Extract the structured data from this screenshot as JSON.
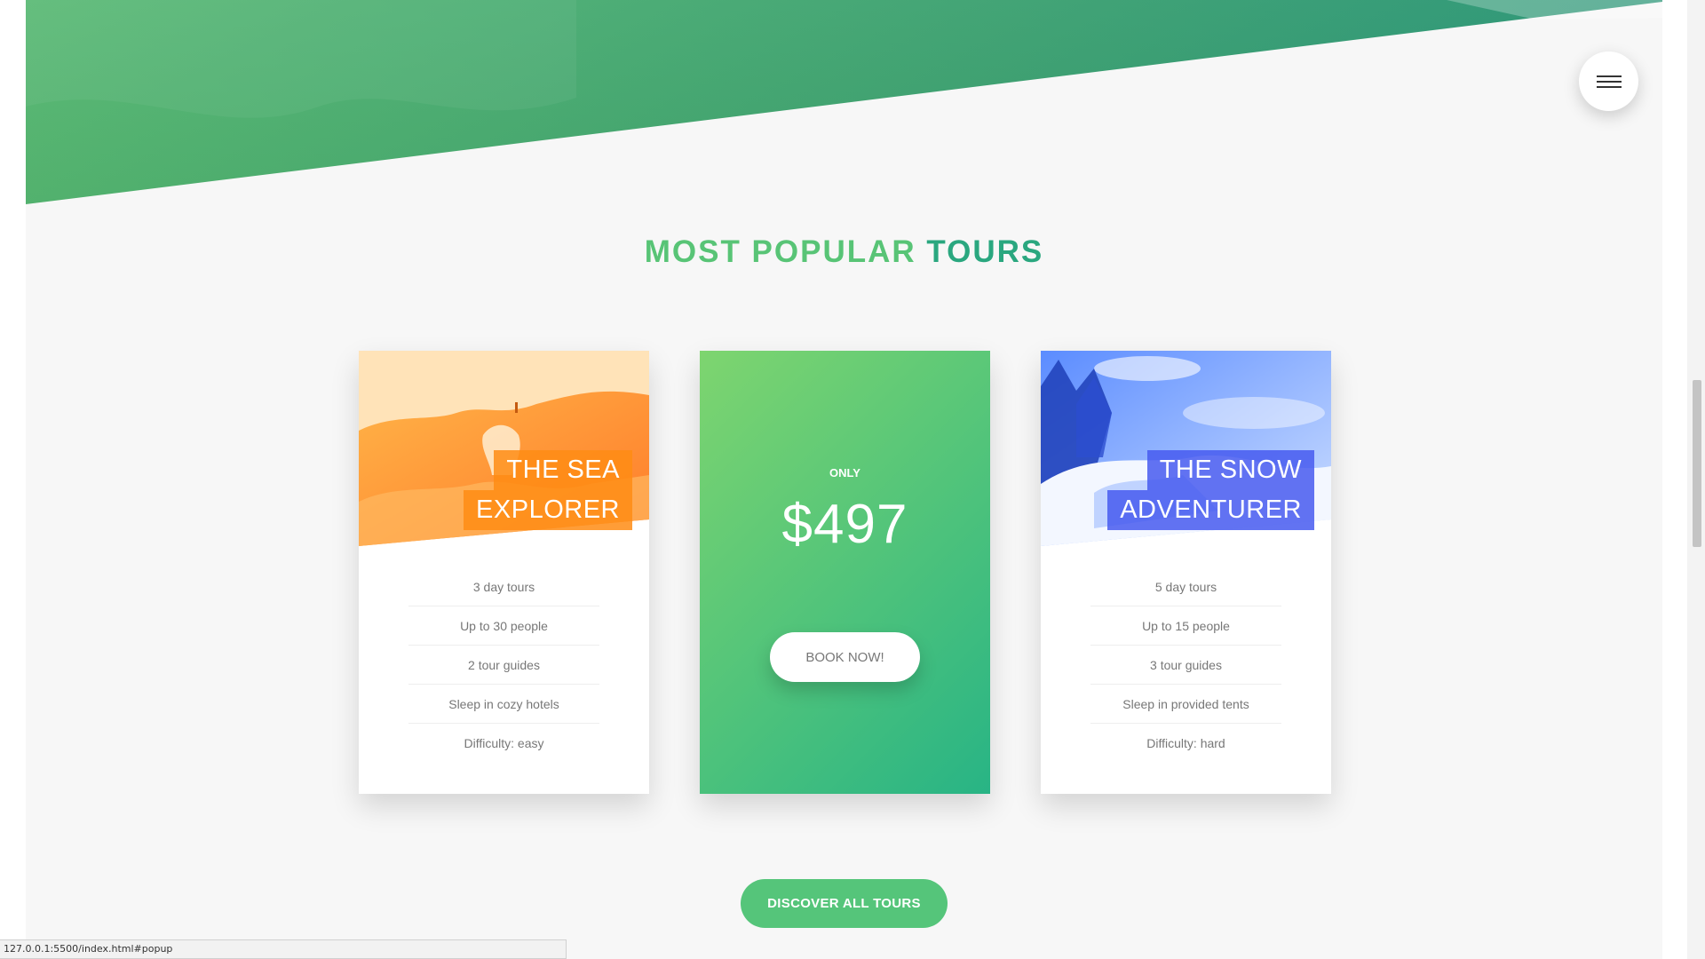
{
  "page": {
    "status_url": "127.0.0.1:5500/index.html#popup"
  },
  "menu": {
    "icon": "hamburger-menu-icon"
  },
  "section": {
    "heading_part1": "MOST POPULAR",
    "heading_part2": "TOURS"
  },
  "tours": [
    {
      "title_line1": "THE SEA",
      "title_line2": "EXPLORER",
      "details": [
        "3 day tours",
        "Up to 30 people",
        "2 tour guides",
        "Sleep in cozy hotels",
        "Difficulty: easy"
      ]
    },
    {
      "title_line1": "THE SNOW",
      "title_line2": "ADVENTURER",
      "details": [
        "5 day tours",
        "Up to 15 people",
        "3 tour guides",
        "Sleep in provided tents",
        "Difficulty: hard"
      ]
    }
  ],
  "price_card": {
    "only_label": "ONLY",
    "price": "$497",
    "button_label": "BOOK NOW!"
  },
  "cta": {
    "discover_label": "DISCOVER ALL TOURS"
  },
  "colors": {
    "green_light": "#7ed56f",
    "green_dark": "#28b485",
    "orange": "#ff9a2a",
    "blue": "#4a63f0",
    "background": "#f7f7f7"
  }
}
